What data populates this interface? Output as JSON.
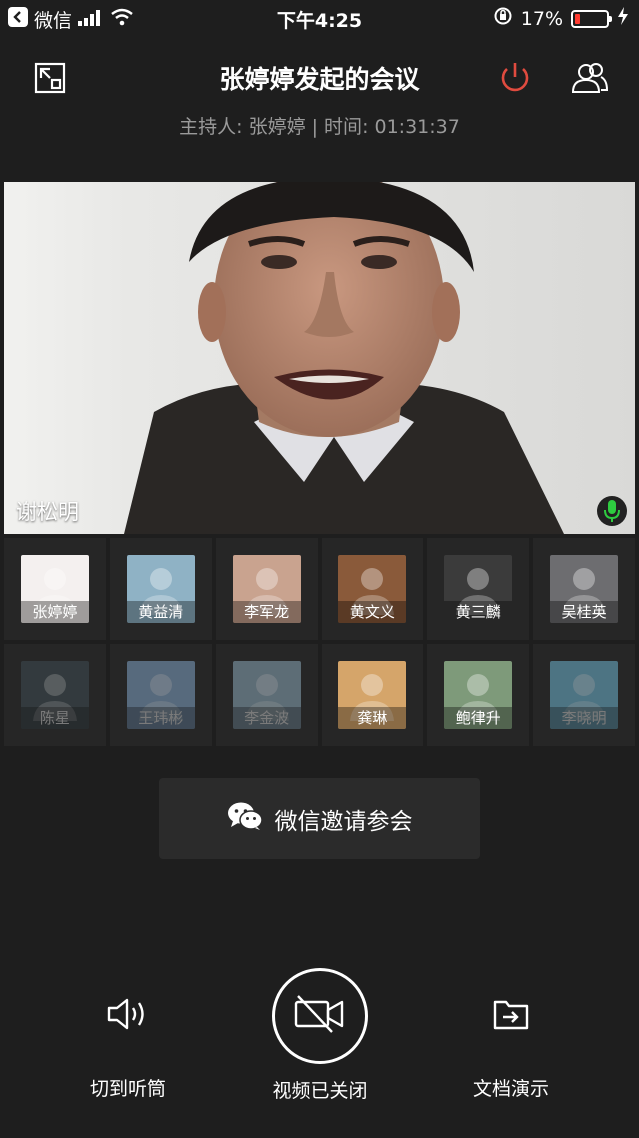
{
  "status_bar": {
    "carrier": "微信",
    "time": "下午4:25",
    "battery_text": "17%",
    "battery_level": 0.17
  },
  "header": {
    "title": "张婷婷发起的会议",
    "subtitle": "主持人: 张婷婷 | 时间: 01:31:37"
  },
  "main_video": {
    "participant_name": "谢松明"
  },
  "participants": [
    {
      "name": "张婷婷",
      "active": true,
      "bg": "#f4f0ef"
    },
    {
      "name": "黄益清",
      "active": true,
      "bg": "#8fb2c5"
    },
    {
      "name": "李军龙",
      "active": true,
      "bg": "#c9a38f"
    },
    {
      "name": "黄文义",
      "active": true,
      "bg": "#8a5a3a"
    },
    {
      "name": "黄三麟",
      "active": true,
      "bg": "#3b3b3b"
    },
    {
      "name": "吴桂英",
      "active": true,
      "bg": "#6d6d70"
    },
    {
      "name": "陈星",
      "active": false,
      "bg": "#3e4c52"
    },
    {
      "name": "王玮彬",
      "active": false,
      "bg": "#7fa2c4"
    },
    {
      "name": "李金波",
      "active": false,
      "bg": "#8aa7b8"
    },
    {
      "name": "龚琳",
      "active": true,
      "bg": "#d5a56a"
    },
    {
      "name": "鲍律升",
      "active": true,
      "bg": "#7e9a7a"
    },
    {
      "name": "李晓明",
      "active": false,
      "bg": "#6eb4d0"
    }
  ],
  "invite": {
    "label": "微信邀请参会"
  },
  "controls": {
    "speaker_label": "切到听筒",
    "video_label": "视频已关闭",
    "doc_label": "文档演示"
  },
  "colors": {
    "background": "#1e1e1e",
    "leave_red": "#e04b3f",
    "mic_green": "#2ecc40"
  }
}
